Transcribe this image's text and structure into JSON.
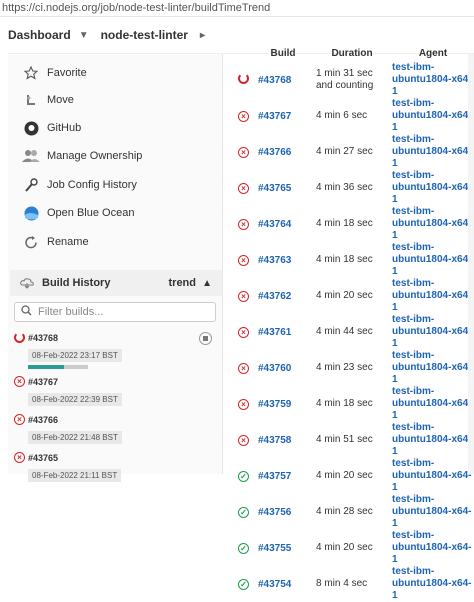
{
  "url": "https://ci.nodejs.org/job/node-test-linter/buildTimeTrend",
  "breadcrumb": [
    "Dashboard",
    "node-test-linter"
  ],
  "sidebar": {
    "items": [
      {
        "label": "Favorite",
        "icon": "star-icon"
      },
      {
        "label": "Move",
        "icon": "move-icon"
      },
      {
        "label": "GitHub",
        "icon": "github-icon"
      },
      {
        "label": "Manage Ownership",
        "icon": "ownership-icon"
      },
      {
        "label": "Job Config History",
        "icon": "config-history-icon"
      },
      {
        "label": "Open Blue Ocean",
        "icon": "blue-ocean-icon"
      },
      {
        "label": "Rename",
        "icon": "rename-icon"
      }
    ]
  },
  "build_history": {
    "title": "Build History",
    "trend": "trend",
    "filter_placeholder": "Filter builds...",
    "builds": [
      {
        "num": "#43768",
        "date": "08-Feb-2022 23:17 BST",
        "status": "running",
        "progress": 0.6
      },
      {
        "num": "#43767",
        "date": "08-Feb-2022 22:39 BST",
        "status": "failed"
      },
      {
        "num": "#43766",
        "date": "08-Feb-2022 21:48 BST",
        "status": "failed"
      },
      {
        "num": "#43765",
        "date": "08-Feb-2022 21:11 BST",
        "status": "failed"
      }
    ]
  },
  "table": {
    "headers": [
      "Build",
      "Duration",
      "Agent"
    ],
    "rows": [
      {
        "build": "#43768",
        "status": "running",
        "duration": "1 min 31 sec and counting",
        "agent": "test-ibm-ubuntu1804-x64-1"
      },
      {
        "build": "#43767",
        "status": "failed",
        "duration": "4 min 6 sec",
        "agent": "test-ibm-ubuntu1804-x64-1"
      },
      {
        "build": "#43766",
        "status": "failed",
        "duration": "4 min 27 sec",
        "agent": "test-ibm-ubuntu1804-x64-1"
      },
      {
        "build": "#43765",
        "status": "failed",
        "duration": "4 min 36 sec",
        "agent": "test-ibm-ubuntu1804-x64-1"
      },
      {
        "build": "#43764",
        "status": "failed",
        "duration": "4 min 18 sec",
        "agent": "test-ibm-ubuntu1804-x64-1"
      },
      {
        "build": "#43763",
        "status": "failed",
        "duration": "4 min 18 sec",
        "agent": "test-ibm-ubuntu1804-x64-1"
      },
      {
        "build": "#43762",
        "status": "failed",
        "duration": "4 min 20 sec",
        "agent": "test-ibm-ubuntu1804-x64-1"
      },
      {
        "build": "#43761",
        "status": "failed",
        "duration": "4 min 44 sec",
        "agent": "test-ibm-ubuntu1804-x64-1"
      },
      {
        "build": "#43760",
        "status": "failed",
        "duration": "4 min 23 sec",
        "agent": "test-ibm-ubuntu1804-x64-1"
      },
      {
        "build": "#43759",
        "status": "failed",
        "duration": "4 min 18 sec",
        "agent": "test-ibm-ubuntu1804-x64-1"
      },
      {
        "build": "#43758",
        "status": "failed",
        "duration": "4 min 51 sec",
        "agent": "test-ibm-ubuntu1804-x64-1"
      },
      {
        "build": "#43757",
        "status": "success",
        "duration": "4 min 20 sec",
        "agent": "test-ibm-ubuntu1804-x64-1"
      },
      {
        "build": "#43756",
        "status": "success",
        "duration": "4 min 28 sec",
        "agent": "test-ibm-ubuntu1804-x64-1"
      },
      {
        "build": "#43755",
        "status": "success",
        "duration": "4 min 20 sec",
        "agent": "test-ibm-ubuntu1804-x64-1"
      },
      {
        "build": "#43754",
        "status": "success",
        "duration": "8 min 4 sec",
        "agent": "test-ibm-ubuntu1804-x64-1"
      }
    ]
  },
  "colors": {
    "fail": "#d0272d",
    "success": "#1a9e4b",
    "link": "#1e64b4"
  }
}
